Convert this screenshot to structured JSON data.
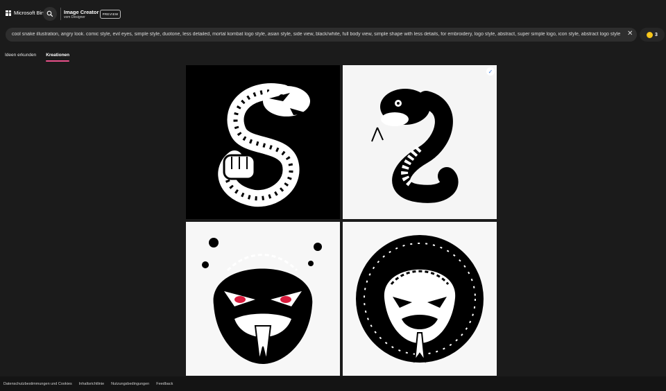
{
  "header": {
    "brand": "Microsoft Bing",
    "app_title": "Image Creator",
    "app_subtitle": "vom Designer",
    "preview_badge": "PREVIEW"
  },
  "prompt": {
    "text": "cool snake illustration, angry look. comic style, evil eyes, simple style, duotone, less detailed, mortal kombat logo style, asian style, side view, black/white, full body view, simple shape with less details, for embroidery, logo style, abstract, super simple logo, icon style, abstract logo style",
    "clear_icon": "close-icon"
  },
  "credits": {
    "count": "3",
    "icon": "coin-icon"
  },
  "tabs": [
    {
      "label": "Ideen erkunden",
      "active": false
    },
    {
      "label": "Kreationen",
      "active": true
    }
  ],
  "results": {
    "images": [
      {
        "description_icon": "snake-coiled-fist-image",
        "background": "#000000",
        "selected": false
      },
      {
        "description_icon": "cobra-raised-image",
        "background": "#f5f5f5",
        "selected": true
      },
      {
        "description_icon": "snake-face-red-eyes-image",
        "background": "#f7f7f7",
        "selected": false
      },
      {
        "description_icon": "snake-round-badge-image",
        "background": "#f7f7f7",
        "selected": false
      }
    ]
  },
  "footer": {
    "links": [
      "Datenschutzbestimmungen und Cookies",
      "Inhaltsrichtlinie",
      "Nutzungsbedingungen",
      "Feedback"
    ]
  },
  "colors": {
    "background": "#1b1b1b",
    "accent": "#e8508a",
    "coin": "#f5c518"
  }
}
